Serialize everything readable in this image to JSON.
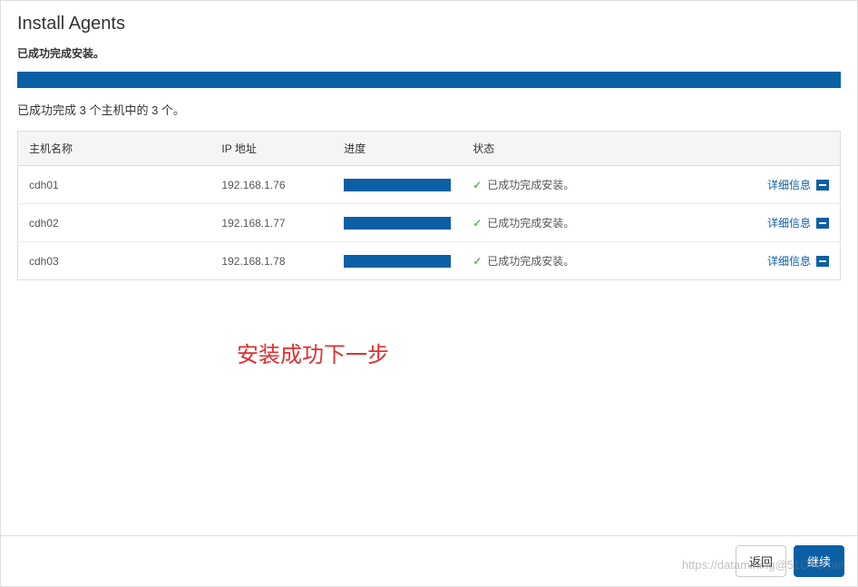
{
  "page": {
    "title": "Install Agents",
    "success_msg": "已成功完成安装。",
    "summary": "已成功完成 3 个主机中的 3 个。"
  },
  "table": {
    "headers": {
      "hostname": "主机名称",
      "ip": "IP 地址",
      "progress": "进度",
      "status": "状态"
    },
    "details_label": "详细信息",
    "rows": [
      {
        "hostname": "cdh01",
        "ip": "192.168.1.76",
        "status": "已成功完成安装。"
      },
      {
        "hostname": "cdh02",
        "ip": "192.168.1.77",
        "status": "已成功完成安装。"
      },
      {
        "hostname": "cdh03",
        "ip": "192.168.1.78",
        "status": "已成功完成安装。"
      }
    ]
  },
  "annotation": "安装成功下一步",
  "footer": {
    "back": "返回",
    "continue": "继续"
  },
  "watermark": "https://datamining@51CTO.net"
}
